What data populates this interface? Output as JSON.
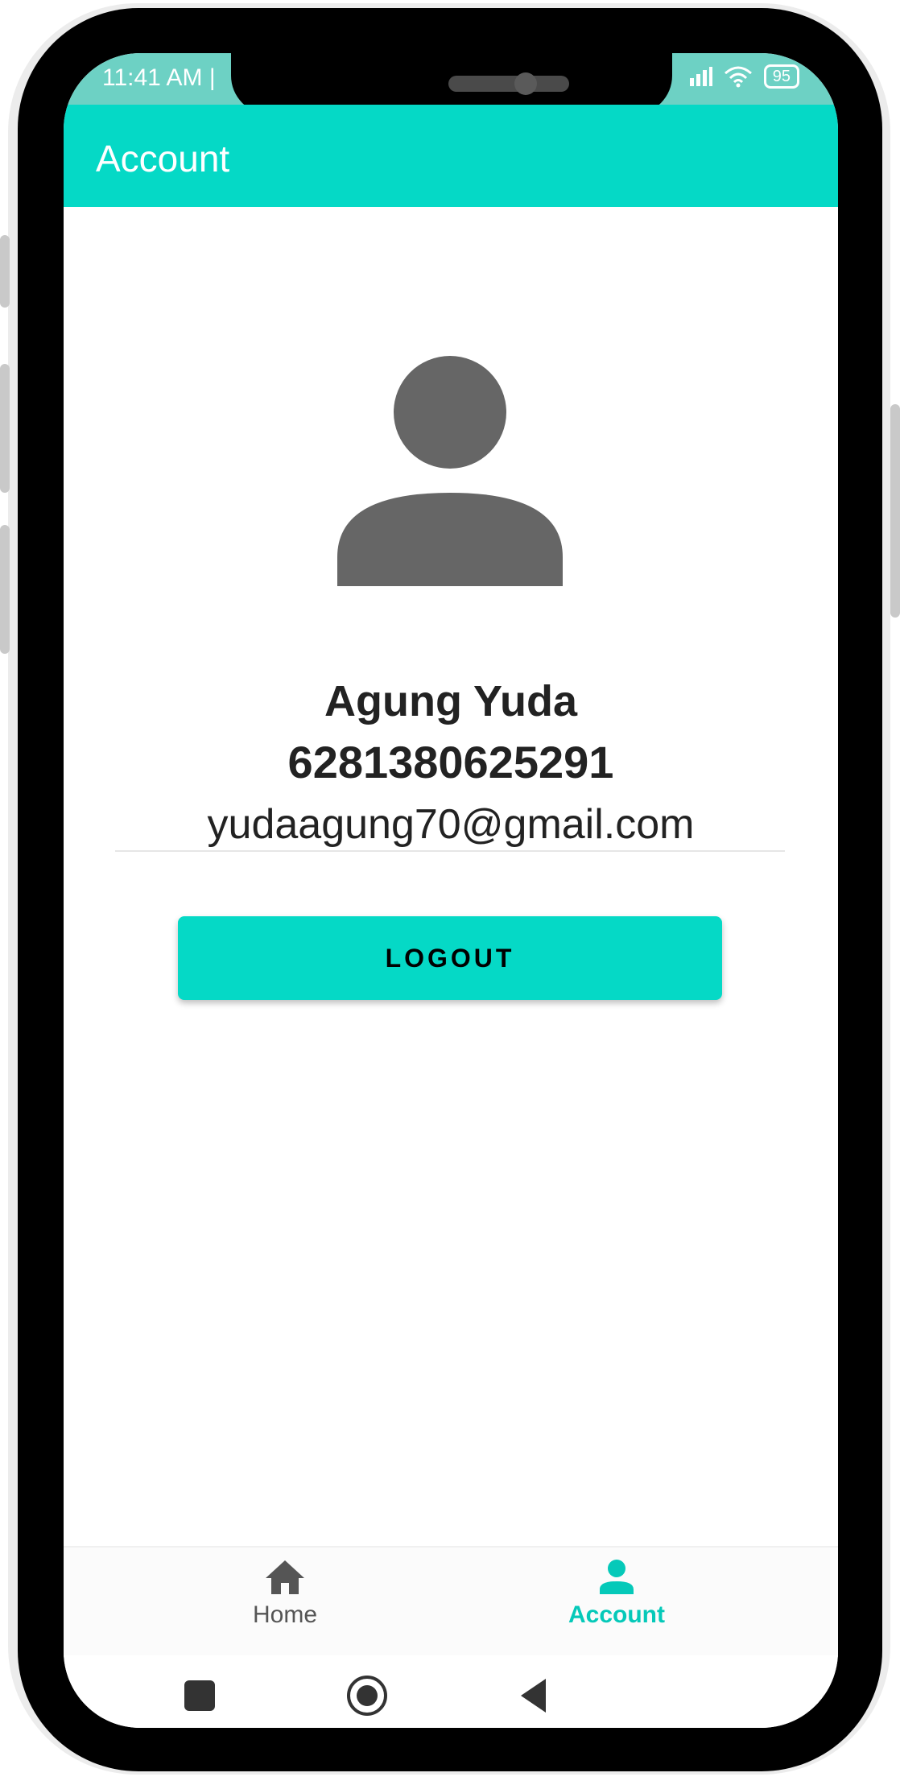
{
  "status_bar": {
    "time": "11:41 AM |",
    "battery": "95"
  },
  "app_bar": {
    "title": "Account"
  },
  "profile": {
    "name": "Agung Yuda",
    "phone": "6281380625291",
    "email": "yudaagung70@gmail.com"
  },
  "actions": {
    "logout_label": "LOGOUT"
  },
  "bottom_nav": {
    "items": [
      {
        "label": "Home",
        "icon": "home-icon",
        "active": false
      },
      {
        "label": "Account",
        "icon": "person-icon",
        "active": true
      }
    ]
  },
  "colors": {
    "accent": "#05d9c6",
    "status_bar": "#6dd1c4",
    "avatar": "#666666",
    "nav_inactive": "#555555",
    "nav_active": "#05c9b9"
  }
}
